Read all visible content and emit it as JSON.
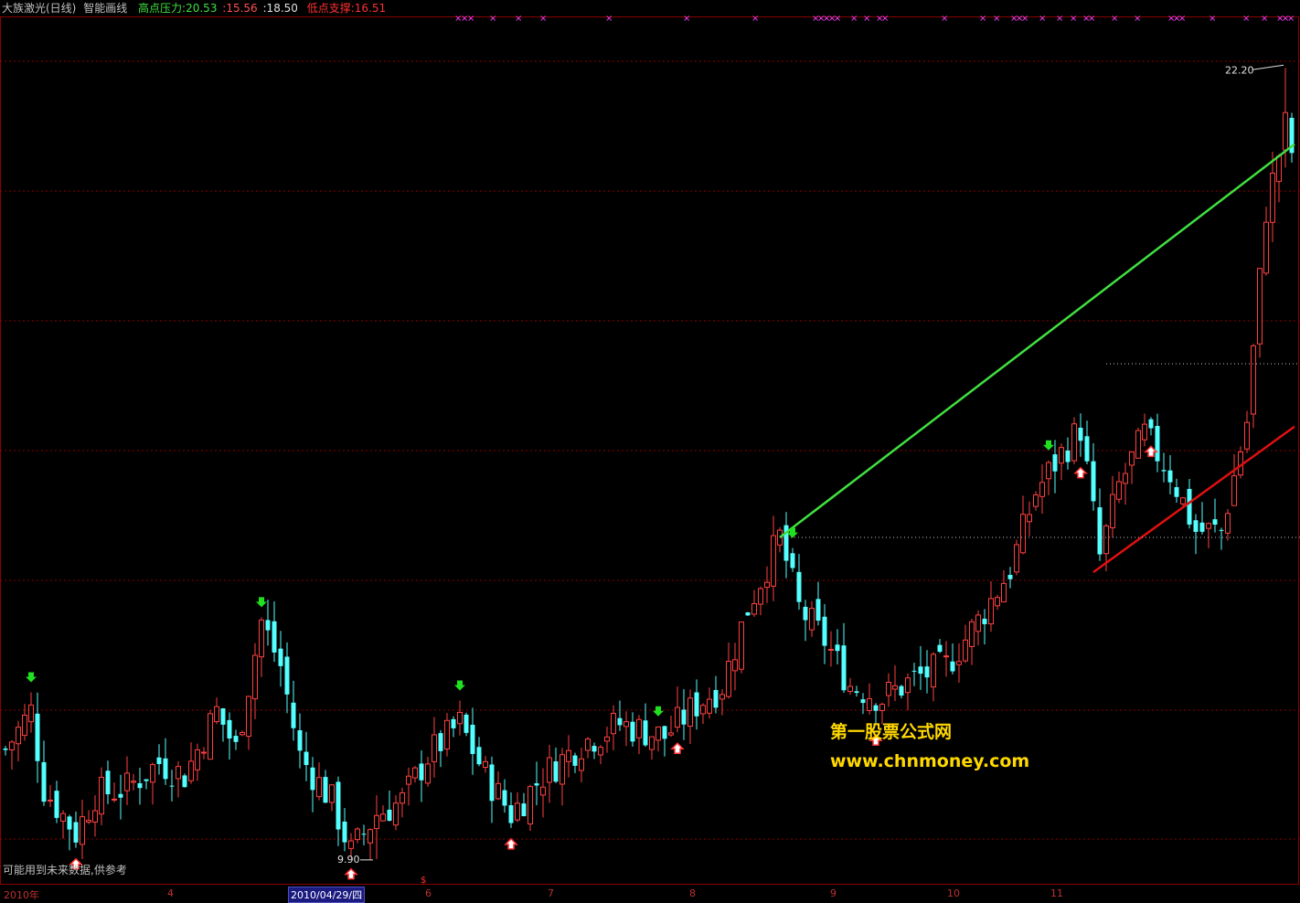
{
  "header": {
    "stock_name": "大族激光(日线)",
    "indicator_name": "智能画线",
    "high_label": "高点压力:",
    "high_value": "20.53",
    "val2": ":15.56",
    "val3": ":18.50",
    "low_label": "低点支撑:",
    "low_value": "16.51"
  },
  "footer_note": "可能用到未来数据,供参考",
  "watermark": {
    "line1": "第一股票公式网",
    "line2": "www.chnmoney.com"
  },
  "x_axis": {
    "labels": [
      "2010年",
      "4",
      "2010/04/29/四",
      "6",
      "7",
      "8",
      "9",
      "10",
      "11"
    ],
    "selected": "2010/04/29/四"
  },
  "annotations": {
    "max_label": "22.20",
    "min_label": "9.90"
  },
  "colors": {
    "up": "#ff4040",
    "down": "#54ffff",
    "pressure_line": "#40e040",
    "support_line": "#e01010",
    "grid": "#8b0000",
    "marker_x": "#ff40ff",
    "down_arrow": "#20e020",
    "up_arrow": "#ff3030",
    "text_high": "#40e040",
    "text_low": "#ff3030"
  },
  "chart_data": {
    "type": "candlestick",
    "y_range": [
      9.5,
      23.0
    ],
    "price_max": 22.2,
    "price_min": 9.9,
    "lines": [
      {
        "name": "高点压力",
        "from": [
          121,
          14.9
        ],
        "to": [
          200,
          20.9
        ]
      },
      {
        "name": "低点支撑",
        "from": [
          170,
          14.36
        ],
        "to": [
          200,
          16.51
        ]
      }
    ],
    "sell_signal_bars": [
      4,
      40,
      71,
      102,
      123,
      163
    ],
    "buy_signal_bars": [
      11,
      54,
      79,
      105,
      136,
      168,
      179
    ]
  }
}
